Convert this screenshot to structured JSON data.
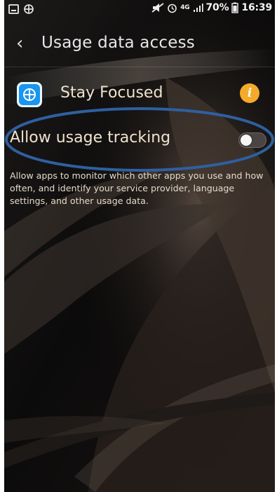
{
  "status_bar": {
    "battery_percent": "70%",
    "time": "16:39",
    "network": "4G",
    "icons": [
      "notification-icon",
      "crosshair-icon",
      "muted-icon",
      "alarm-icon",
      "signal-icon",
      "battery-icon"
    ]
  },
  "app_bar": {
    "back_icon": "chevron-left-icon",
    "title": "Usage data access"
  },
  "app_entry": {
    "name": "Stay Focused",
    "icon": "target-icon",
    "info_label": "i"
  },
  "setting": {
    "label": "Allow usage tracking",
    "enabled": false
  },
  "description": "Allow apps to monitor which other apps you use and how often, and identify your service provider, language settings, and other usage data.",
  "colors": {
    "accent": "#f4aa2a",
    "highlight": "#2f5fa0",
    "app_icon": "#1a95f0",
    "text": "#efe3cc"
  }
}
